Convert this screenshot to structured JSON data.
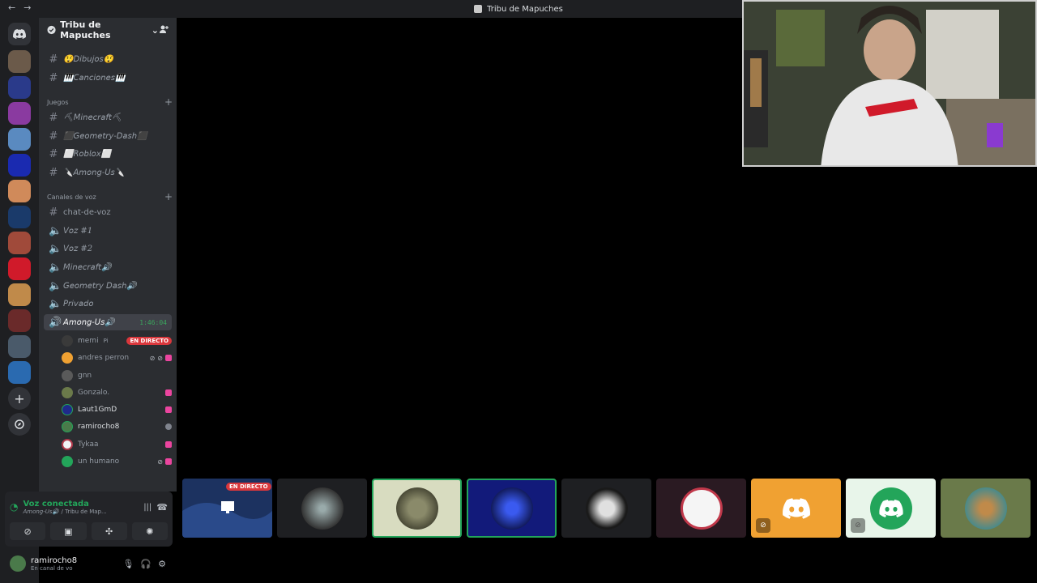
{
  "window": {
    "title": "Tribu de Mapuches",
    "back": "←",
    "forward": "→"
  },
  "guild": {
    "name": "Tribu de Mapuches"
  },
  "channels": [
    {
      "name": "😲𝘋𝘪𝘣𝘶𝘫𝘰𝘴😲",
      "icon": "#",
      "style": "italic"
    },
    {
      "name": "🎹𝘊𝘢𝘯𝘤𝘪𝘰𝘯𝘦𝘴🎹",
      "icon": "#",
      "style": "italic"
    }
  ],
  "categories": [
    {
      "name": "Juegos",
      "plus": "+"
    },
    {
      "name": "Canales de voz",
      "plus": "+"
    }
  ],
  "game_channels": [
    {
      "name": "⛏𝘔𝘪𝘯𝘦𝘤𝘳𝘢𝘧𝘵⛏"
    },
    {
      "name": "⬛𝘎𝘦𝘰𝘮𝘦𝘵𝘳𝘺-𝘋𝘢𝘴𝘩⬛"
    },
    {
      "name": "⬜𝘙𝘰𝘣𝘭𝘰𝘹⬜"
    },
    {
      "name": "🔪𝘈𝘮𝘰𝘯𝘨-𝘜𝘴🔪"
    }
  ],
  "voice_channels": [
    {
      "name": "chat-de-voz",
      "icon": "#"
    },
    {
      "name": "𝘝𝘰𝘻 #1"
    },
    {
      "name": "𝘝𝘰𝘻 #2"
    },
    {
      "name": "𝘔𝘪𝘯𝘦𝘤𝘳𝘢𝘧𝘵🔊"
    },
    {
      "name": "𝘎𝘦𝘰𝘮𝘦𝘵𝘳𝘺 𝘋𝘢𝘴𝘩🔊"
    },
    {
      "name": "𝘗𝘳𝘪𝘷𝘢𝘥𝘰"
    },
    {
      "name": "𝘈𝘮𝘰𝘯𝘨-𝘜𝘴🔊",
      "timer": "1:46:04"
    }
  ],
  "voice_users": [
    {
      "name": "memi",
      "extra": "Pi",
      "badge": "EN DIRECTO",
      "color": "#3a3a3a"
    },
    {
      "name": "andres perron",
      "color": "#f0a132"
    },
    {
      "name": "gnn",
      "color": "#5a5a5a"
    },
    {
      "name": "Gonzalo.",
      "color": "#6b7a4a"
    },
    {
      "name": "Laut1GmD",
      "color": "#1f2a8a"
    },
    {
      "name": "ramirocho8",
      "color": "#4a7a4a"
    },
    {
      "name": "Tykaa",
      "color": "#f2f3f5"
    },
    {
      "name": "un humano",
      "color": "#23a55a"
    }
  ],
  "voice_panel": {
    "status": "Voz conectada",
    "location": "𝘈𝘮𝘰𝘯𝘨-𝘜𝘴🔊 / Tribu de Map..."
  },
  "user": {
    "name": "ramirocho8",
    "status": "En canal de vo"
  },
  "tiles": [
    {
      "name": "stream-tile",
      "badge": "EN DIRECTO"
    },
    {
      "name": "robot-tile"
    },
    {
      "name": "gonzalo-tile"
    },
    {
      "name": "laut-tile"
    },
    {
      "name": "white-figure-tile"
    },
    {
      "name": "tykaa-tile"
    },
    {
      "name": "andres-tile"
    },
    {
      "name": "humano-tile"
    },
    {
      "name": "gnn-tile"
    }
  ],
  "colors": {
    "accent_green": "#23a55a",
    "live_red": "#da373c",
    "discord_blurple": "#5865f2"
  }
}
